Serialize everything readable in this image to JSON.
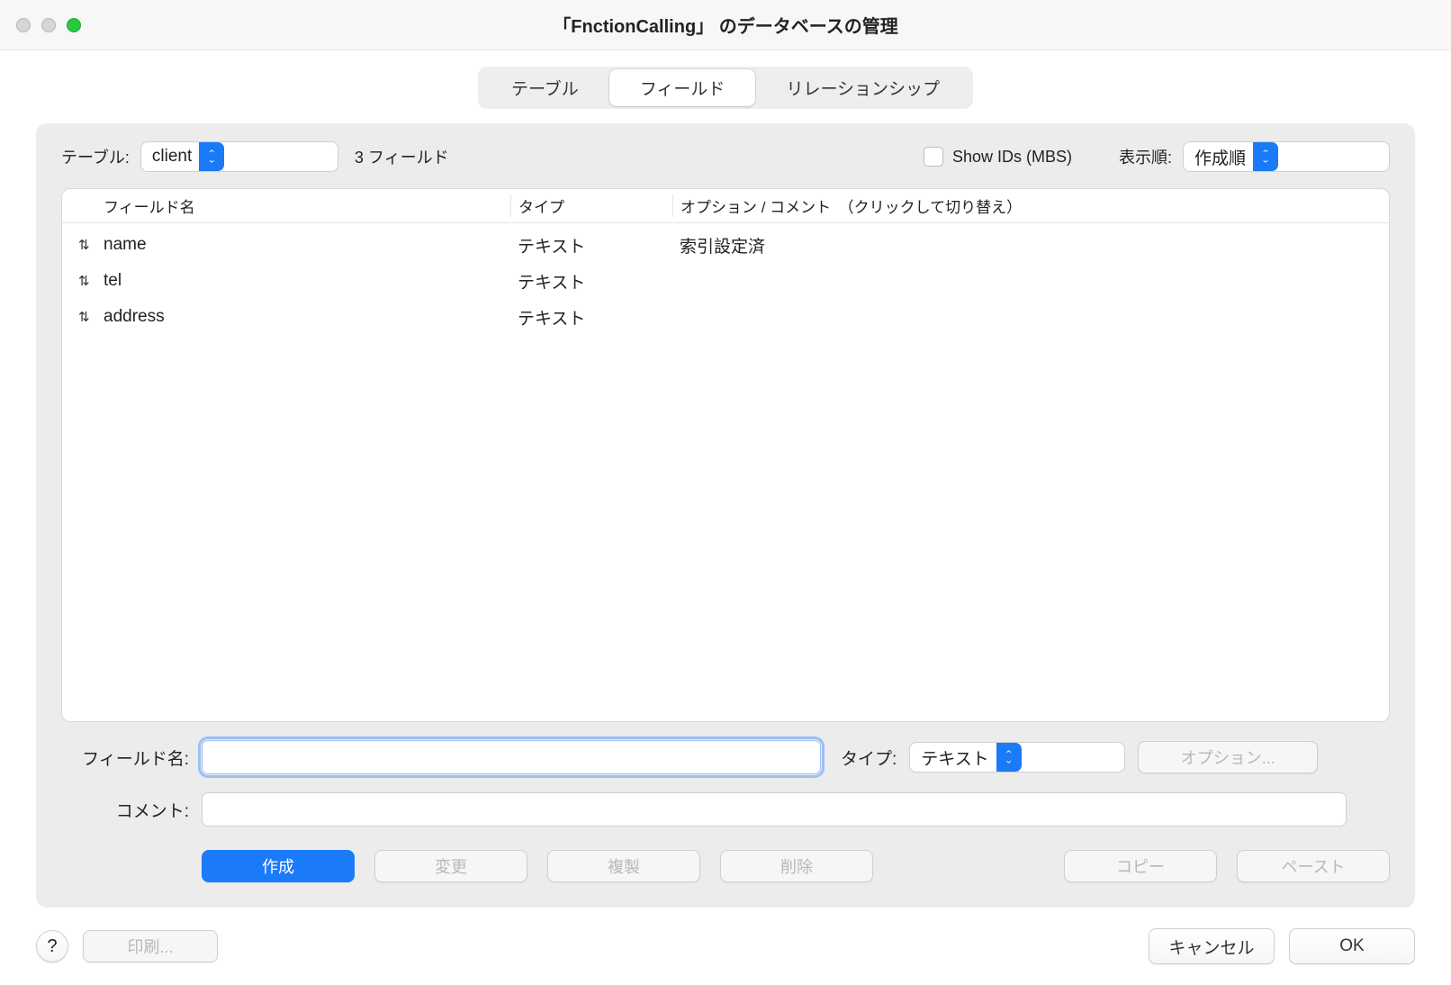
{
  "window": {
    "title": "「FnctionCalling」 のデータベースの管理"
  },
  "tabs": {
    "table": "テーブル",
    "field": "フィールド",
    "relationship": "リレーションシップ",
    "active": "field"
  },
  "toolbar": {
    "table_label": "テーブル:",
    "table_value": "client",
    "field_count": "3 フィールド",
    "show_ids_label": "Show IDs (MBS)",
    "sort_label": "表示順:",
    "sort_value": "作成順"
  },
  "columns": {
    "name": "フィールド名",
    "type": "タイプ",
    "options": "オプション / コメント　（クリックして切り替え）"
  },
  "fields": [
    {
      "name": "name",
      "type": "テキスト",
      "options": "索引設定済"
    },
    {
      "name": "tel",
      "type": "テキスト",
      "options": ""
    },
    {
      "name": "address",
      "type": "テキスト",
      "options": ""
    }
  ],
  "form": {
    "fieldname_label": "フィールド名:",
    "fieldname_value": "",
    "type_label": "タイプ:",
    "type_value": "テキスト",
    "options_button": "オプション...",
    "comment_label": "コメント:",
    "comment_value": ""
  },
  "actions": {
    "create": "作成",
    "change": "変更",
    "duplicate": "複製",
    "delete": "削除",
    "copy": "コピー",
    "paste": "ペースト"
  },
  "footer": {
    "help": "?",
    "print": "印刷...",
    "cancel": "キャンセル",
    "ok": "OK"
  }
}
